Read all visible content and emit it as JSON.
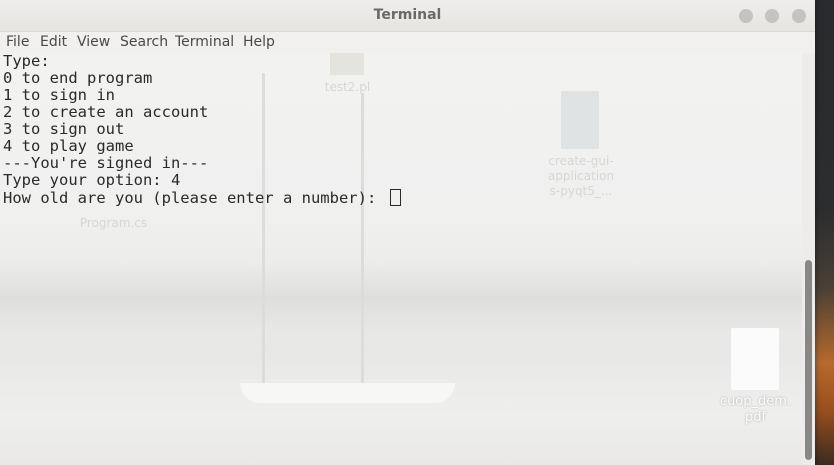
{
  "window": {
    "title": "Terminal"
  },
  "menu": [
    "File",
    "Edit",
    "View",
    "Search",
    "Terminal",
    "Help"
  ],
  "terminal": {
    "lines": [
      "Type:",
      "0 to end program",
      "1 to sign in",
      "2 to create an account",
      "3 to sign out",
      "4 to play game",
      "---You're signed in---",
      "Type your option: 4"
    ],
    "prompt": "How old are you (please enter a number): "
  },
  "desktop": {
    "pdf_icon_label": "cuop_dem.\npdf",
    "ghost_labels": {
      "test2": "test2.pl",
      "program": "Program.cs",
      "create_gui": "create-gui-\napplication\ns-pyqt5_..."
    }
  },
  "colors": {
    "title_text": "#6b6966",
    "terminal_text": "#2a2a2a",
    "scroll_thumb": "#8a8884"
  }
}
